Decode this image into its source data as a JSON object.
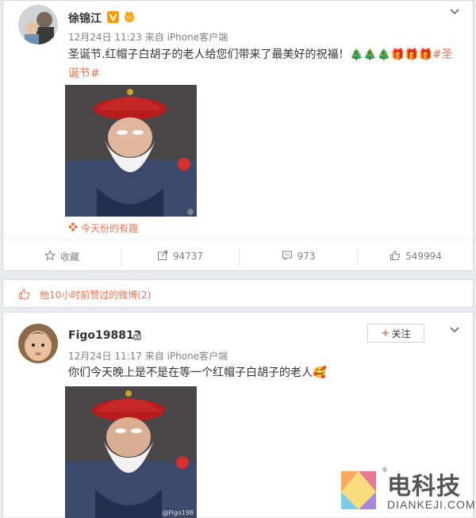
{
  "post1": {
    "username": "徐锦江",
    "timestamp": "12月24日 11:23",
    "source": "来自 iPhone客户端",
    "text": "圣诞节.红帽子白胡子的老人给您们带来了最美好的祝福！🎄🎄🎄🎁🎁🎁",
    "hashtag": "#圣诞节#",
    "image_watermark": "@",
    "topic_link": "今天份的有趣",
    "actions": {
      "favorite": "收藏",
      "repost": "94737",
      "comment": "973",
      "like": "549994"
    }
  },
  "liked_bar": {
    "label": "他10小时前赞过的微博(2)"
  },
  "post2": {
    "username": "Figo198812",
    "timestamp": "12月24日 11:17",
    "source": "来自 iPhone客户端",
    "text": "你们今天晚上是不是在等一个红帽子白胡子的老人🥰",
    "follow_label": "关注",
    "image_watermark": "@Figo198"
  },
  "watermark": {
    "brand": "电科技",
    "domain": "DIANKEJI.COM"
  },
  "colors": {
    "accent": "#eb7350",
    "link": "#eb7350",
    "muted": "#808080"
  }
}
